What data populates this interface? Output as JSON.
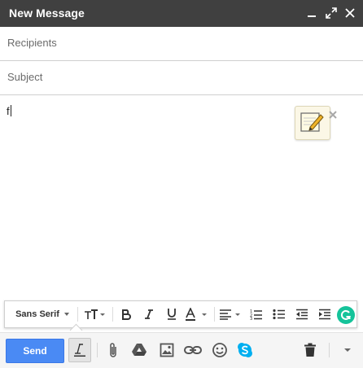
{
  "window": {
    "title": "New Message",
    "controls": [
      "minimize-icon",
      "expand-icon",
      "close-icon"
    ]
  },
  "fields": {
    "recipients_placeholder": "Recipients",
    "subject_placeholder": "Subject"
  },
  "body": {
    "text": "f"
  },
  "formatting_bar": {
    "font": "Sans Serif",
    "tools": [
      "font-size-icon",
      "bold-icon",
      "italic-icon",
      "underline-icon",
      "text-color-icon",
      "align-icon",
      "numbered-list-icon",
      "bulleted-list-icon",
      "indent-less-icon",
      "indent-more-icon"
    ]
  },
  "bottom_bar": {
    "send_label": "Send",
    "tools": [
      "formatting-icon",
      "attach-icon",
      "drive-icon",
      "photo-icon",
      "link-icon",
      "emoji-icon",
      "skype-icon",
      "trash-icon",
      "more-options-icon"
    ]
  },
  "colors": {
    "titlebar": "#404040",
    "send_button": "#4a8af4",
    "skype": "#00aff0",
    "grammarly": "#15c39a"
  }
}
